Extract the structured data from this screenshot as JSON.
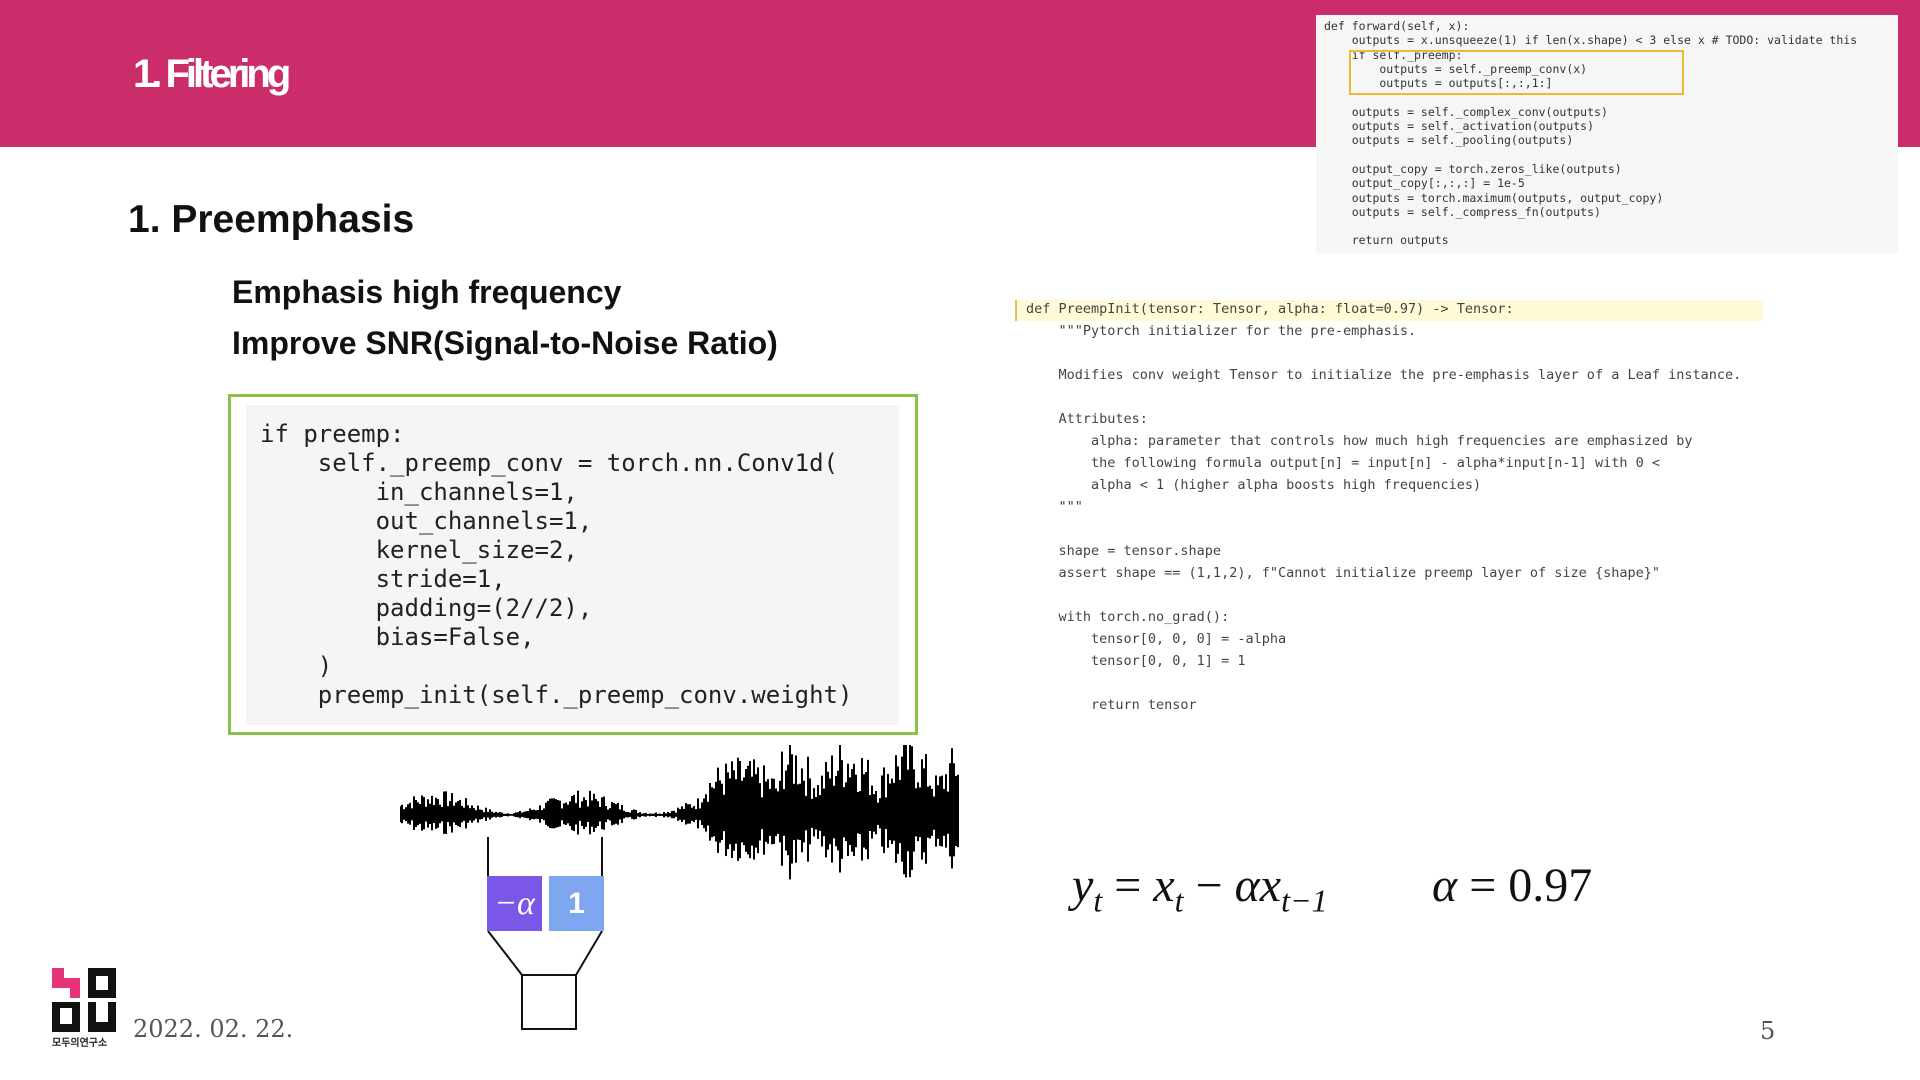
{
  "header": {
    "title": "1. Filtering"
  },
  "section": {
    "title": "1. Preemphasis"
  },
  "bullets": [
    "Emphasis high frequency",
    "Improve SNR(Signal-to-Noise Ratio)"
  ],
  "top_code": {
    "lines": [
      "def forward(self, x):",
      "    outputs = x.unsqueeze(1) if len(x.shape) < 3 else x # TODO: validate this",
      "    if self._preemp:",
      "        outputs = self._preemp_conv(x)",
      "        outputs = outputs[:,:,1:]",
      "",
      "    outputs = self._complex_conv(outputs)",
      "    outputs = self._activation(outputs)",
      "    outputs = self._pooling(outputs)",
      "",
      "    output_copy = torch.zeros_like(outputs)",
      "    output_copy[:,:,:] = 1e-5",
      "    outputs = torch.maximum(outputs, output_copy)",
      "    outputs = self._compress_fn(outputs)",
      "",
      "    return outputs"
    ]
  },
  "main_code": {
    "lines": [
      "if preemp:",
      "    self._preemp_conv = torch.nn.Conv1d(",
      "        in_channels=1,",
      "        out_channels=1,",
      "        kernel_size=2,",
      "        stride=1,",
      "        padding=(2//2),",
      "        bias=False,",
      "    )",
      "    preemp_init(self._preemp_conv.weight)"
    ]
  },
  "doc_code": {
    "lines": [
      "def PreempInit(tensor: Tensor, alpha: float=0.97) -> Tensor:",
      "    \"\"\"Pytorch initializer for the pre-emphasis.",
      "",
      "    Modifies conv weight Tensor to initialize the pre-emphasis layer of a Leaf instance.",
      "",
      "    Attributes:",
      "        alpha: parameter that controls how much high frequencies are emphasized by",
      "        the following formula output[n] = input[n] - alpha*input[n-1] with 0 <",
      "        alpha < 1 (higher alpha boosts high frequencies)",
      "    \"\"\"",
      "",
      "    shape = tensor.shape",
      "    assert shape == (1,1,2), f\"Cannot initialize preemp layer of size {shape}\"",
      "",
      "    with torch.no_grad():",
      "        tensor[0, 0, 0] = -alpha",
      "        tensor[0, 0, 1] = 1",
      "",
      "        return tensor"
    ]
  },
  "equation": {
    "lhs": "y",
    "lhs_sub": "t",
    "x": "x",
    "x_sub": "t",
    "alpha": "α",
    "x2": "x",
    "x2_sub": "t−1",
    "alpha_value": "0.97"
  },
  "kernel": {
    "first": "−α",
    "second": "1"
  },
  "footer": {
    "date": "2022. 02. 22.",
    "page": "5",
    "logo_caption": "모두의연구소"
  },
  "colors": {
    "header_bg": "#cb2d6a",
    "code_border": "#8bc34a",
    "highlight": "#f2b632",
    "kernel_a": "#7b57e8",
    "kernel_b": "#7ea7f0"
  }
}
